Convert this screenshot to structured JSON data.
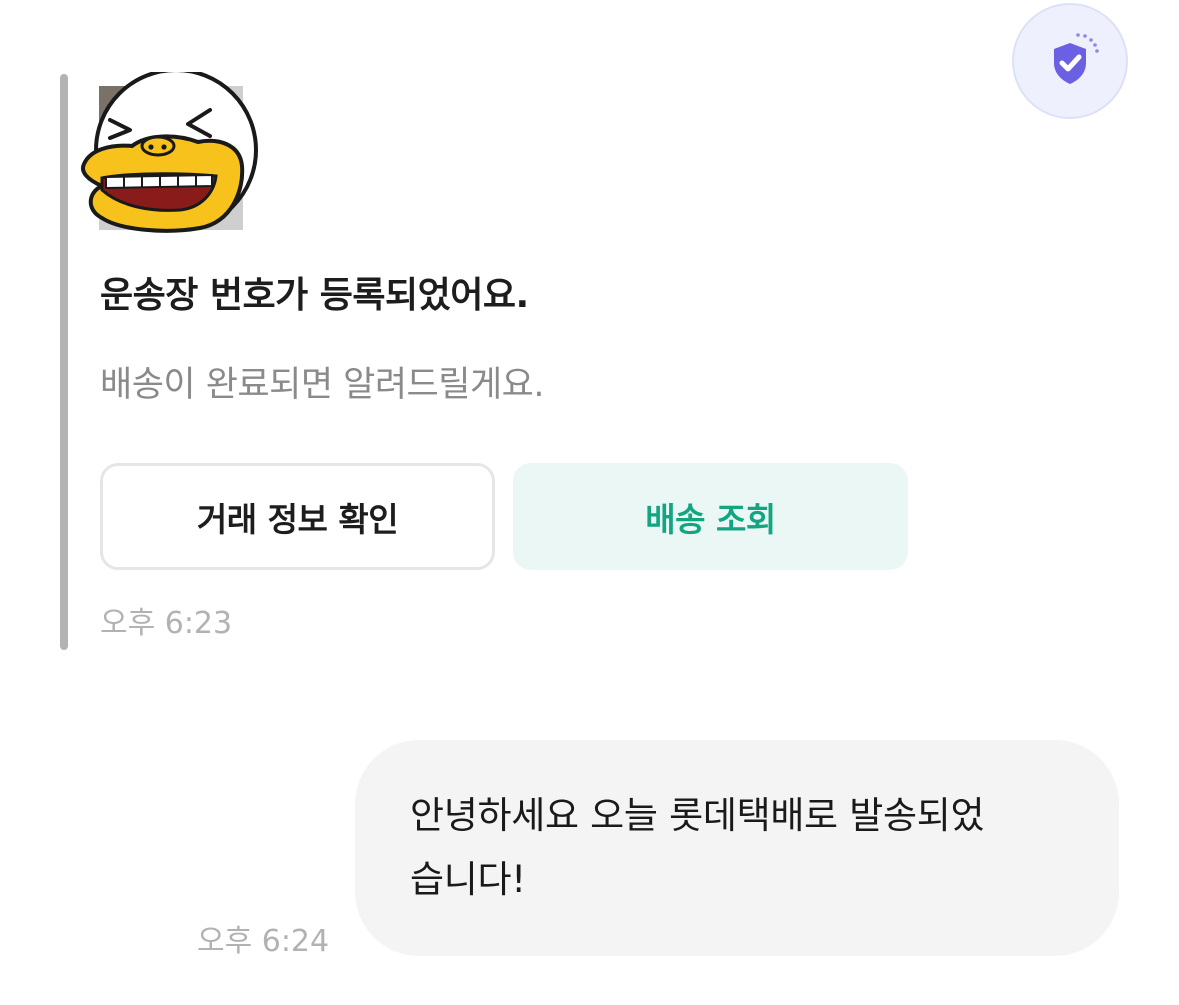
{
  "header": {
    "safety_badge_icon": "shield-check-icon",
    "safety_badge_color": "#6b5fe3"
  },
  "notice": {
    "emoticon_icon": "laughing-duck-emoticon",
    "title": "운송장 번호가 등록되었어요.",
    "body": "배송이 완료되면 알려드릴게요.",
    "buttons": {
      "order_info_label": "거래 정보 확인",
      "shipment_tracking_label": "배송 조회"
    },
    "time": "오후 6:23"
  },
  "message": {
    "text": "안녕하세요 오늘 롯데택배로 발송되었\n습니다!",
    "time": "오후 6:24"
  },
  "colors": {
    "accent_green": "#12a582",
    "accent_green_bg": "#ebf7f4",
    "bubble_bg": "#f4f4f4"
  }
}
